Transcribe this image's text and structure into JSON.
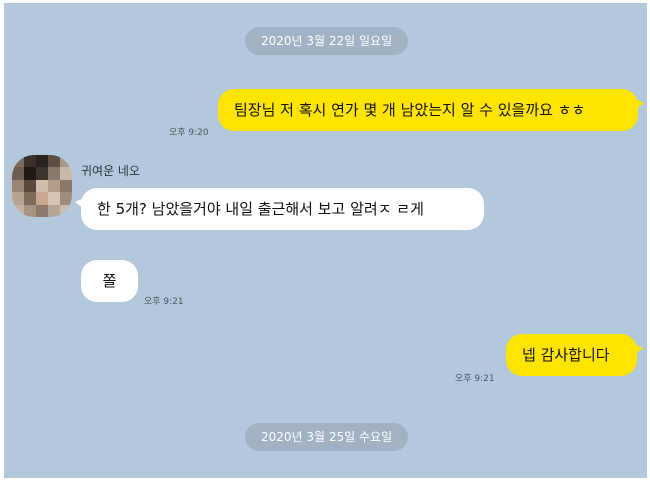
{
  "dates": {
    "first": "2020년 3월 22일 일요일",
    "second": "2020년 3월 25일 수요일"
  },
  "messages": {
    "m1": {
      "text": "팀장님 저 혹시 연가 몇 개 남았는지 알 수 있을까요 ㅎㅎ",
      "time": "오후 9:20"
    },
    "sender_name": "귀여운 네오",
    "m2": {
      "text": "한 5개? 남았을거야 내일 출근해서 보고 알려ㅈ ㄹ게"
    },
    "m3": {
      "text": "쫄",
      "time": "오후 9:21"
    },
    "m4": {
      "text": "넵 감사합니다",
      "time": "오후 9:21"
    }
  },
  "colors": {
    "chat_background": "#b3c8db",
    "my_bubble": "#fee500",
    "their_bubble": "#ffffff",
    "date_pill": "#a0b2c3"
  },
  "icons": {
    "avatar": "pixelated-profile-avatar"
  }
}
